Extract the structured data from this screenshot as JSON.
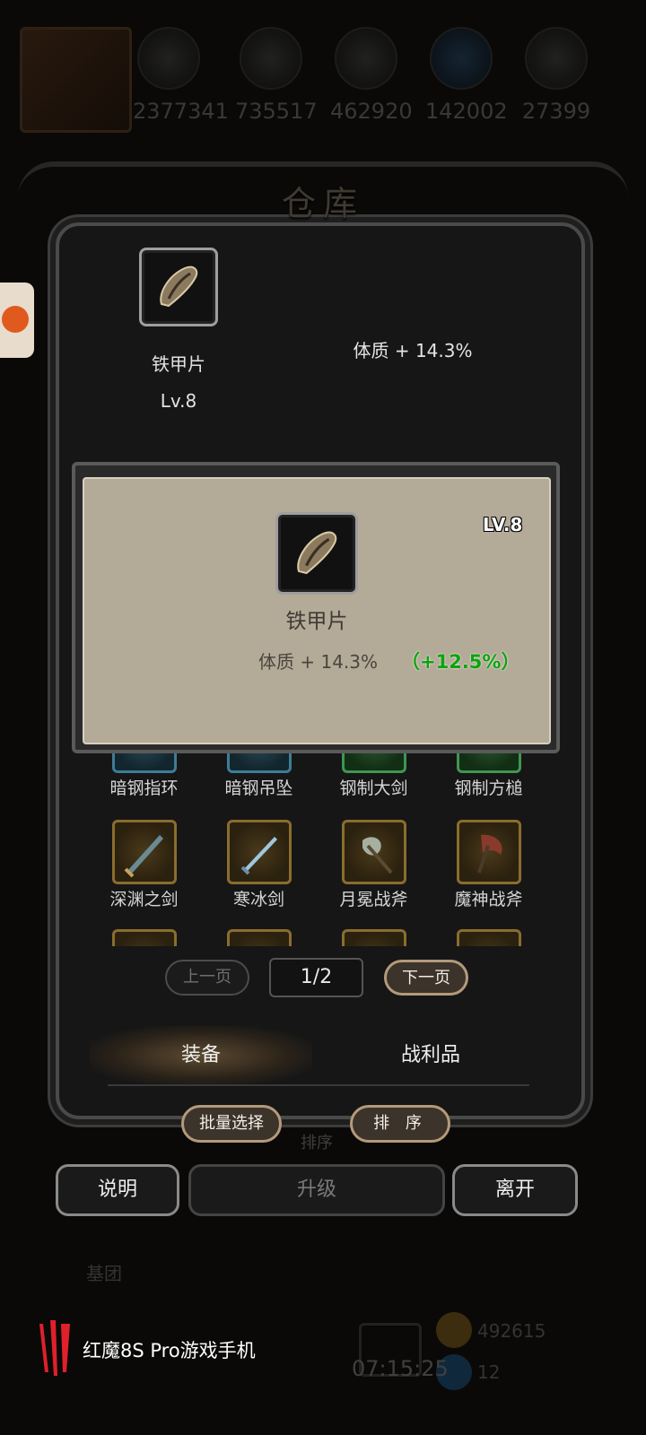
{
  "resources": [
    {
      "icon": "resource-orb-icon",
      "value": "2377341"
    },
    {
      "icon": "resource-wood-icon",
      "value": "735517"
    },
    {
      "icon": "resource-stone-icon",
      "value": "462920"
    },
    {
      "icon": "resource-crystal-icon",
      "value": "142002"
    },
    {
      "icon": "resource-iron-icon",
      "value": "27399"
    }
  ],
  "panel": {
    "title": "仓库",
    "selected": {
      "name": "铁甲片",
      "level": "Lv.8",
      "stat": "体质 + 14.3%"
    }
  },
  "popup": {
    "level": "LV.8",
    "name": "铁甲片",
    "stat": "体质 + 14.3%",
    "bonus": "（+12.5%）"
  },
  "grid": [
    {
      "label": "暗钢指环",
      "tier": "blue"
    },
    {
      "label": "暗钢吊坠",
      "tier": "blue"
    },
    {
      "label": "钢制大剑",
      "tier": "green"
    },
    {
      "label": "钢制方槌",
      "tier": "green"
    },
    {
      "label": "深渊之剑",
      "tier": "gold"
    },
    {
      "label": "寒冰剑",
      "tier": "gold"
    },
    {
      "label": "月冕战斧",
      "tier": "gold"
    },
    {
      "label": "魔神战斧",
      "tier": "gold"
    }
  ],
  "pager": {
    "prev": "上一页",
    "page": "1/2",
    "next": "下一页"
  },
  "tabs": {
    "equip": "装备",
    "loot": "战利品"
  },
  "actions": {
    "batch": "批量选择",
    "sort": "排 序",
    "info": "说明",
    "upgrade": "升级",
    "leave": "离开"
  },
  "background": {
    "sort_hint": "排序",
    "section": "基团",
    "gold": "492615",
    "gems": "12",
    "clock": "07:15:25"
  },
  "watermark": {
    "text": "红魔8S Pro游戏手机"
  },
  "colors": {
    "bonus": "#0ea30e",
    "popup_bg": "#b4aa98",
    "accent_border": "#b39a7a"
  }
}
